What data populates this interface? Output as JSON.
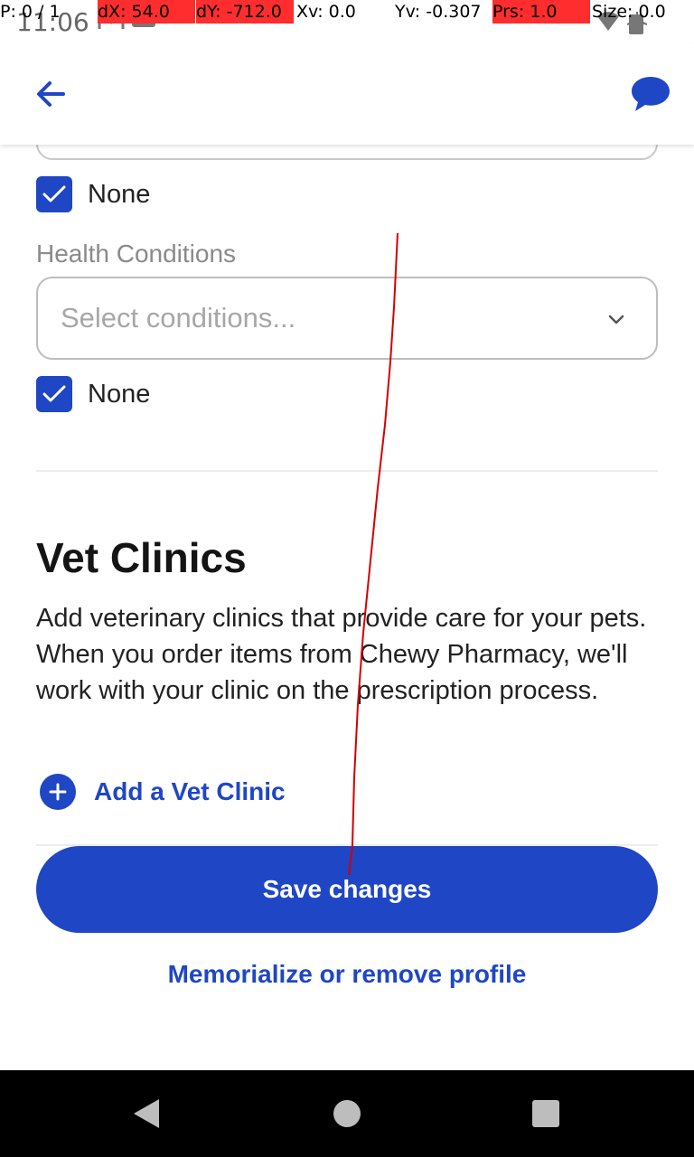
{
  "status_bar": {
    "time": "11:06",
    "left_icons": [
      "gmail-icon",
      "car-icon"
    ],
    "right_icons": [
      "wifi-icon",
      "airplane-icon",
      "battery-icon"
    ]
  },
  "debug_overlay": {
    "p": "P: 0 / 1",
    "dx": "dX: 54.0",
    "dy": "dY: -712.0",
    "xv": "Xv: 0.0",
    "yv": "Yv: -0.307",
    "prs": "Prs: 1.0",
    "size": "Size: 0.0"
  },
  "header": {
    "back_icon": "arrow-left-icon",
    "chat_icon": "chat-bubble-icon",
    "accent_color": "#1f46c4"
  },
  "form": {
    "allergies_none_label": "None",
    "allergies_none_checked": true,
    "health_conditions_label": "Health Conditions",
    "health_conditions_placeholder": "Select conditions...",
    "conditions_none_label": "None",
    "conditions_none_checked": true
  },
  "vet_clinics": {
    "title": "Vet Clinics",
    "description": "Add veterinary clinics that provide care for your pets. When you order items from Chewy Pharmacy, we'll work with your clinic on the prescription process.",
    "add_label": "Add a Vet Clinic"
  },
  "actions": {
    "save_label": "Save changes",
    "remove_label": "Memorialize or remove profile"
  },
  "nav_bar": {
    "icons": [
      "back-triangle-icon",
      "home-circle-icon",
      "recents-square-icon"
    ]
  }
}
